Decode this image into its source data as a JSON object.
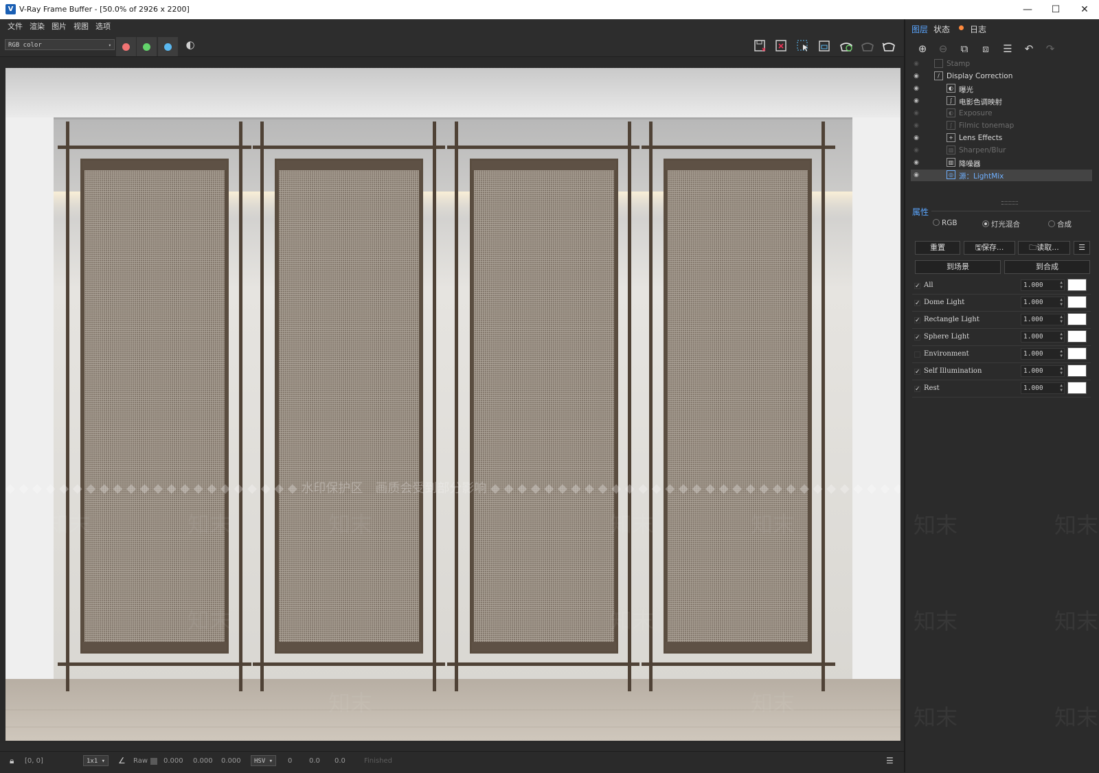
{
  "window": {
    "title": "V-Ray Frame Buffer - [50.0% of 2926 x 2200]",
    "app_icon": "vray-icon",
    "controls": {
      "minimize": "—",
      "maximize": "☐",
      "close": "✕"
    }
  },
  "menu": [
    "文件",
    "渲染",
    "图片",
    "视图",
    "选项"
  ],
  "toolbar": {
    "channel": "RGB color",
    "channel_caret": "▾",
    "color_channels": [
      {
        "name": "red-channel",
        "color": "#f27474"
      },
      {
        "name": "green-channel",
        "color": "#63d46b"
      },
      {
        "name": "blue-channel",
        "color": "#5ab8f0"
      }
    ],
    "mono_icon": "◐",
    "right_icons": [
      "save-image-icon",
      "clear-image-icon",
      "region-render-icon",
      "track-mouse-icon",
      "render-interactive-icon",
      "render-icon-disabled",
      "render-teapot-icon"
    ]
  },
  "render": {
    "watermark_line": "◆ ◆ ◆ ◆ ◆ ◆ ◆ ◆ ◆ ◆ ◆ ◆ ◆ ◆ ◆ ◆ ◆ ◆ ◆ ◆ ◆ ◆ 水印保护区　画质会受到部分影响 ◆ ◆ ◆ ◆ ◆ ◆ ◆ ◆ ◆ ◆ ◆ ◆ ◆ ◆ ◆ ◆ ◆ ◆ ◆ ◆ ◆ ◆ ◆ ◆ ◆ ◆ ◆ ◆ ◆ ◆ ◆ ◆ ◆ ◆",
    "watermark_word": "知末"
  },
  "statusbar": {
    "coords": "[0, 0]",
    "zoom": "1x1",
    "raw_label": "Raw",
    "values": [
      "0.000",
      "0.000",
      "0.000"
    ],
    "color_mode": "HSV",
    "hsv_values": [
      "0",
      "0.0",
      "0.0"
    ],
    "status": "Finished"
  },
  "panel": {
    "tabs": [
      {
        "label": "图层",
        "active": true
      },
      {
        "label": "状态",
        "active": false
      },
      {
        "label": "日志",
        "active": false
      }
    ],
    "log_dot_color": "#ff8a3d",
    "layers": [
      {
        "name": "Stamp",
        "indent": 0,
        "visible": false,
        "enabled": false,
        "icon": "S"
      },
      {
        "name": "Display Correction",
        "indent": 0,
        "visible": true,
        "enabled": true,
        "icon": "/"
      },
      {
        "name": "曝光",
        "indent": 1,
        "visible": true,
        "enabled": true,
        "icon": "◐"
      },
      {
        "name": "电影色调映射",
        "indent": 1,
        "visible": true,
        "enabled": true,
        "icon": "∫"
      },
      {
        "name": "Exposure",
        "indent": 1,
        "visible": false,
        "enabled": false,
        "icon": "◐"
      },
      {
        "name": "Filmic tonemap",
        "indent": 1,
        "visible": false,
        "enabled": false,
        "icon": "∫"
      },
      {
        "name": "Lens Effects",
        "indent": 1,
        "visible": true,
        "enabled": true,
        "icon": "+"
      },
      {
        "name": "Sharpen/Blur",
        "indent": 1,
        "visible": false,
        "enabled": false,
        "icon": "▨"
      },
      {
        "name": "降噪器",
        "indent": 1,
        "visible": true,
        "enabled": true,
        "icon": "▥"
      },
      {
        "name": "源：LightMix",
        "indent": 1,
        "visible": true,
        "enabled": true,
        "icon": "◎",
        "selected": true
      }
    ],
    "properties_title": "属性",
    "mode_options": [
      {
        "label": "RGB",
        "selected": false
      },
      {
        "label": "灯光混合",
        "selected": true
      },
      {
        "label": "合成",
        "selected": false
      }
    ],
    "buttons": {
      "reset": "重置",
      "save": "保存...",
      "load": "读取...",
      "to_scene": "到场景",
      "to_composite": "到合成"
    },
    "lightmix": [
      {
        "name": "All",
        "checked": true,
        "value": "1.000"
      },
      {
        "name": "Dome Light",
        "checked": true,
        "value": "1.000"
      },
      {
        "name": "Rectangle Light",
        "checked": true,
        "value": "1.000"
      },
      {
        "name": "Sphere Light",
        "checked": true,
        "value": "1.000"
      },
      {
        "name": "Environment",
        "checked": false,
        "value": "1.000"
      },
      {
        "name": "Self Illumination",
        "checked": true,
        "value": "1.000"
      },
      {
        "name": "Rest",
        "checked": true,
        "value": "1.000"
      }
    ]
  }
}
